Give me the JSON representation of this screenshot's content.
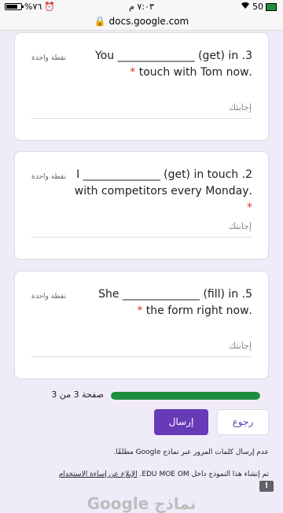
{
  "status_bar": {
    "carrier_battery_left": "%٧٦",
    "time": "٧:٠٣ م",
    "battery_right": "50"
  },
  "browser": {
    "url": "docs.google.com"
  },
  "questions": [
    {
      "points": "نقطة واحدة",
      "line1": "You ______________ (get) in .3",
      "line2": ".touch with Tom now",
      "required_mark": "*",
      "answer_placeholder": "إجابتك"
    },
    {
      "points": "نقطة واحدة",
      "line1": "I ______________ (get) in touch .2",
      "line2": ".with competitors every Monday",
      "required_mark": "*",
      "answer_placeholder": "إجابتك"
    },
    {
      "points": "نقطة واحدة",
      "line1": "She ______________ (fill) in .5",
      "line2": ".the form right now",
      "required_mark": "*",
      "answer_placeholder": "إجابتك"
    }
  ],
  "progress": {
    "label": "صفحة 3 من 3",
    "fraction": 1.0,
    "color": "#1e8e3e"
  },
  "buttons": {
    "back": "رجوع",
    "submit": "إرسال"
  },
  "footer": {
    "password_notice": "عدم إرسال كلمات المرور عبر نماذج Google مطلقًا.",
    "created_in": "تم إنشاء هذا النموذج داخل EDU MOE OM.",
    "report_link": "الإبلاغ عن إساءة الاستخدام"
  },
  "brand": "Google نماذج",
  "colors": {
    "accent": "#673ab7",
    "background": "#f0ebf8",
    "required": "#d93025"
  }
}
